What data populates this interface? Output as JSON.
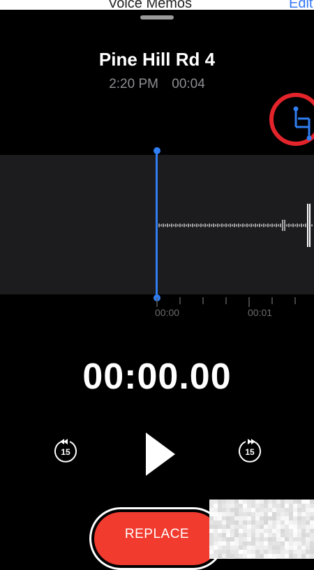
{
  "background_screen": {
    "title": "Voice Memos",
    "edit_label": "Edit"
  },
  "recording": {
    "title": "Pine Hill Rd 4",
    "time": "2:20 PM",
    "duration": "00:04"
  },
  "waveform": {
    "tick_labels": [
      "00:00",
      "00:01"
    ]
  },
  "player": {
    "elapsed": "00:00.00",
    "skip_back_label": "15",
    "skip_forward_label": "15"
  },
  "actions": {
    "replace_label": "REPLACE"
  },
  "colors": {
    "accent_blue": "#2f7ef2",
    "record_red": "#f23b2f",
    "highlight_circle": "#e3242b"
  },
  "icons": [
    "crop-icon",
    "skip-back-15-icon",
    "play-icon",
    "skip-forward-15-icon"
  ]
}
